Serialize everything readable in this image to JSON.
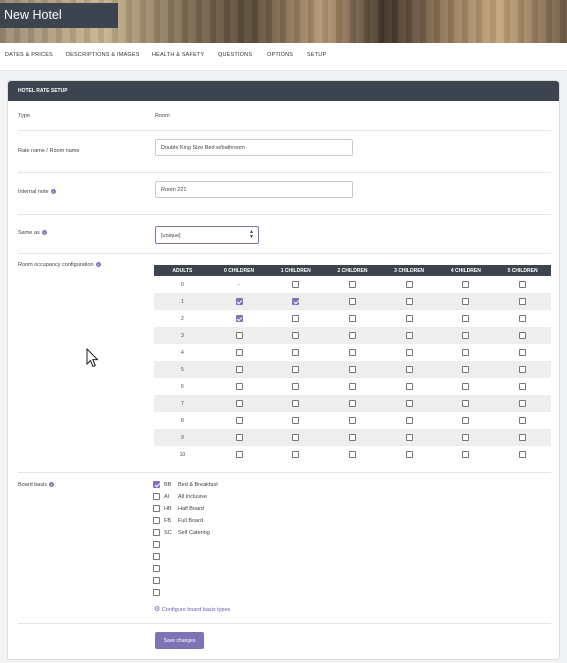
{
  "hotel": {
    "title": "New Hotel"
  },
  "tabs": [
    "Dates & Prices",
    "Descriptions & Images",
    "Health & Safety",
    "Questions",
    "Options",
    "Setup"
  ],
  "panel": {
    "title": "Hotel Rate Setup"
  },
  "form": {
    "type_label": "Type",
    "type_value": "Room",
    "rate_name_label": "Rate name / Room name",
    "rate_name_value": "Double King Size Bed w/bathroom",
    "internal_note_label": "Internal note",
    "internal_note_value": "Room 221",
    "same_as_label": "Same as",
    "same_as_value": "[unique]",
    "occupancy_label": "Room occupancy configuration",
    "board_label": "Board basis"
  },
  "occupancy": {
    "headers": [
      "Adults",
      "0 Children",
      "1 Children",
      "2 Children",
      "3 Children",
      "4 Children",
      "5 Children"
    ],
    "rows": [
      {
        "adults": "0",
        "cells": [
          "-",
          false,
          false,
          false,
          false,
          false
        ]
      },
      {
        "adults": "1",
        "cells": [
          true,
          true,
          false,
          false,
          false,
          false
        ]
      },
      {
        "adults": "2",
        "cells": [
          true,
          false,
          false,
          false,
          false,
          false
        ]
      },
      {
        "adults": "3",
        "cells": [
          false,
          false,
          false,
          false,
          false,
          false
        ]
      },
      {
        "adults": "4",
        "cells": [
          false,
          false,
          false,
          false,
          false,
          false
        ]
      },
      {
        "adults": "5",
        "cells": [
          false,
          false,
          false,
          false,
          false,
          false
        ]
      },
      {
        "adults": "6",
        "cells": [
          false,
          false,
          false,
          false,
          false,
          false
        ]
      },
      {
        "adults": "7",
        "cells": [
          false,
          false,
          false,
          false,
          false,
          false
        ]
      },
      {
        "adults": "8",
        "cells": [
          false,
          false,
          false,
          false,
          false,
          false
        ]
      },
      {
        "adults": "9",
        "cells": [
          false,
          false,
          false,
          false,
          false,
          false
        ]
      },
      {
        "adults": "10",
        "cells": [
          false,
          false,
          false,
          false,
          false,
          false
        ]
      }
    ]
  },
  "board_basis": [
    {
      "code": "BB",
      "name": "Bed & Breakfast",
      "checked": true
    },
    {
      "code": "AI",
      "name": "All Inclusive",
      "checked": false
    },
    {
      "code": "HB",
      "name": "Half Board",
      "checked": false
    },
    {
      "code": "FB",
      "name": "Full Board",
      "checked": false
    },
    {
      "code": "SC",
      "name": "Self Catering",
      "checked": false
    },
    {
      "code": "",
      "name": "",
      "checked": false
    },
    {
      "code": "",
      "name": "",
      "checked": false
    },
    {
      "code": "",
      "name": "",
      "checked": false
    },
    {
      "code": "",
      "name": "",
      "checked": false
    },
    {
      "code": "",
      "name": "",
      "checked": false
    }
  ],
  "configure_link": "Configure board basis types",
  "save_label": "Save changes",
  "colors": {
    "accent": "#7d74b8",
    "header": "#3c4450"
  },
  "icons": {
    "info": "info-icon",
    "gear": "gear-icon",
    "cursor": "mouse-pointer-icon"
  }
}
